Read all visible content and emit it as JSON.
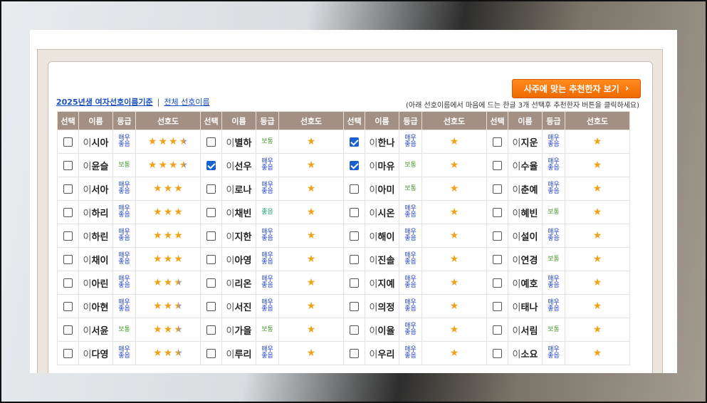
{
  "header": {
    "recommend_button": "사주에 맞는 추천한자 보기",
    "link_main": "2025년생 여자선호이름기준",
    "separator": "|",
    "link_all": "전체 선호이름",
    "hint": "(아래 선호이름에서 마음에 드는 한글 3개 선택후 추천한자 버튼을 클릭하세요)"
  },
  "columns": [
    "선택",
    "이름",
    "등급",
    "선호도"
  ],
  "surname": "이",
  "grades": {
    "good": "매우\n좋음",
    "normal": "보통",
    "fine": "좋음"
  },
  "rows": [
    [
      {
        "n": "시아",
        "g": "good",
        "s": 3.5,
        "c": false
      },
      {
        "n": "별하",
        "g": "normal",
        "s": 1,
        "c": false
      },
      {
        "n": "한나",
        "g": "good",
        "s": 1,
        "c": true
      },
      {
        "n": "지운",
        "g": "good",
        "s": 1,
        "c": false
      }
    ],
    [
      {
        "n": "윤슬",
        "g": "normal",
        "s": 3.5,
        "c": false
      },
      {
        "n": "선우",
        "g": "good",
        "s": 1,
        "c": true
      },
      {
        "n": "마유",
        "g": "normal",
        "s": 1,
        "c": true
      },
      {
        "n": "수율",
        "g": "good",
        "s": 1,
        "c": false
      }
    ],
    [
      {
        "n": "서아",
        "g": "good",
        "s": 3,
        "c": false
      },
      {
        "n": "로나",
        "g": "good",
        "s": 1,
        "c": false
      },
      {
        "n": "아미",
        "g": "normal",
        "s": 1,
        "c": false
      },
      {
        "n": "춘예",
        "g": "good",
        "s": 1,
        "c": false
      }
    ],
    [
      {
        "n": "하리",
        "g": "good",
        "s": 3,
        "c": false
      },
      {
        "n": "채빈",
        "g": "fine",
        "s": 1,
        "c": false
      },
      {
        "n": "시온",
        "g": "good",
        "s": 1,
        "c": false
      },
      {
        "n": "혜빈",
        "g": "normal",
        "s": 1,
        "c": false
      }
    ],
    [
      {
        "n": "하린",
        "g": "good",
        "s": 3,
        "c": false
      },
      {
        "n": "지한",
        "g": "good",
        "s": 1,
        "c": false
      },
      {
        "n": "해이",
        "g": "good",
        "s": 1,
        "c": false
      },
      {
        "n": "설이",
        "g": "good",
        "s": 1,
        "c": false
      }
    ],
    [
      {
        "n": "채이",
        "g": "good",
        "s": 3,
        "c": false
      },
      {
        "n": "아영",
        "g": "good",
        "s": 1,
        "c": false
      },
      {
        "n": "진솔",
        "g": "good",
        "s": 1,
        "c": false
      },
      {
        "n": "연경",
        "g": "normal",
        "s": 1,
        "c": false
      }
    ],
    [
      {
        "n": "아린",
        "g": "good",
        "s": 2.5,
        "c": false
      },
      {
        "n": "리온",
        "g": "good",
        "s": 1,
        "c": false
      },
      {
        "n": "지예",
        "g": "good",
        "s": 1,
        "c": false
      },
      {
        "n": "예호",
        "g": "good",
        "s": 1,
        "c": false
      }
    ],
    [
      {
        "n": "아현",
        "g": "good",
        "s": 2.5,
        "c": false
      },
      {
        "n": "서진",
        "g": "good",
        "s": 1,
        "c": false
      },
      {
        "n": "의정",
        "g": "good",
        "s": 1,
        "c": false
      },
      {
        "n": "태나",
        "g": "good",
        "s": 1,
        "c": false
      }
    ],
    [
      {
        "n": "서윤",
        "g": "normal",
        "s": 2.5,
        "c": false
      },
      {
        "n": "가을",
        "g": "normal",
        "s": 1,
        "c": false
      },
      {
        "n": "이율",
        "g": "good",
        "s": 1,
        "c": false
      },
      {
        "n": "서림",
        "g": "normal",
        "s": 1,
        "c": false
      }
    ],
    [
      {
        "n": "다영",
        "g": "good",
        "s": 2.5,
        "c": false
      },
      {
        "n": "루리",
        "g": "good",
        "s": 1,
        "c": false
      },
      {
        "n": "우리",
        "g": "good",
        "s": 1,
        "c": false
      },
      {
        "n": "소요",
        "g": "good",
        "s": 1,
        "c": false
      }
    ]
  ]
}
